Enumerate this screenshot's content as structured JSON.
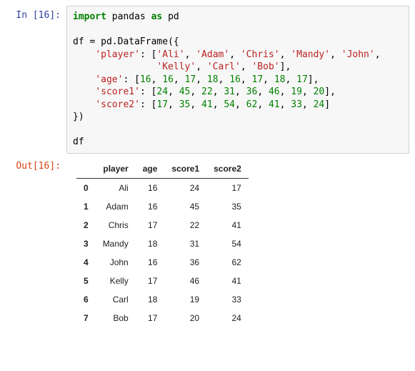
{
  "prompts": {
    "in": "In [16]:",
    "out": "Out[16]:"
  },
  "code": {
    "kw_import": "import",
    "mod": " pandas ",
    "kw_as": "as",
    "alias": " pd",
    "l2a": "df = pd.DataFrame({",
    "l3a": "    ",
    "s_player": "'player'",
    "l3b": ": [",
    "s_ali": "'Ali'",
    "s_adam": "'Adam'",
    "s_chris": "'Chris'",
    "s_mandy": "'Mandy'",
    "s_john": "'John'",
    "l3c": ",",
    "l4a": "               ",
    "s_kelly": "'Kelly'",
    "s_carl": "'Carl'",
    "s_bob": "'Bob'",
    "l4b": "],",
    "l5a": "    ",
    "s_age": "'age'",
    "l5b": ": [",
    "a0": "16",
    "a1": "16",
    "a2": "17",
    "a3": "18",
    "a4": "16",
    "a5": "17",
    "a6": "18",
    "a7": "17",
    "l5c": "],",
    "l6a": "    ",
    "s_s1": "'score1'",
    "l6b": ": [",
    "s10": "24",
    "s11": "45",
    "s12": "22",
    "s13": "31",
    "s14": "36",
    "s15": "46",
    "s16": "19",
    "s17": "20",
    "l6c": "],",
    "l7a": "    ",
    "s_s2": "'score2'",
    "l7b": ": [",
    "s20": "17",
    "s21": "35",
    "s22": "41",
    "s23": "54",
    "s24": "62",
    "s25": "41",
    "s26": "33",
    "s27": "24",
    "l7c": "]",
    "l8": "})",
    "l9": "df",
    "comma": ", "
  },
  "chart_data": {
    "type": "table",
    "columns": [
      "player",
      "age",
      "score1",
      "score2"
    ],
    "index": [
      "0",
      "1",
      "2",
      "3",
      "4",
      "5",
      "6",
      "7"
    ],
    "rows": [
      {
        "player": "Ali",
        "age": "16",
        "score1": "24",
        "score2": "17"
      },
      {
        "player": "Adam",
        "age": "16",
        "score1": "45",
        "score2": "35"
      },
      {
        "player": "Chris",
        "age": "17",
        "score1": "22",
        "score2": "41"
      },
      {
        "player": "Mandy",
        "age": "18",
        "score1": "31",
        "score2": "54"
      },
      {
        "player": "John",
        "age": "16",
        "score1": "36",
        "score2": "62"
      },
      {
        "player": "Kelly",
        "age": "17",
        "score1": "46",
        "score2": "41"
      },
      {
        "player": "Carl",
        "age": "18",
        "score1": "19",
        "score2": "33"
      },
      {
        "player": "Bob",
        "age": "17",
        "score1": "20",
        "score2": "24"
      }
    ]
  }
}
